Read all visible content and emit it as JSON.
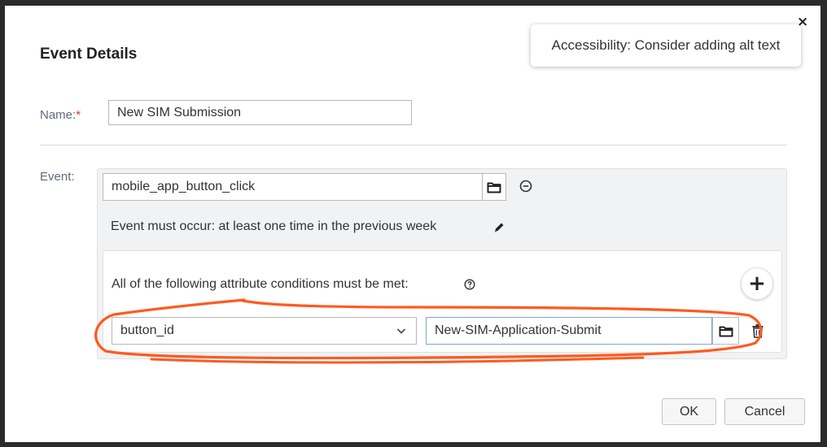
{
  "dialog": {
    "title": "Event Details",
    "close_label": "×"
  },
  "tooltip": {
    "text": "Accessibility: Consider adding alt text"
  },
  "name_field": {
    "label": "Name:",
    "required_marker": "*",
    "value": "New SIM Submission"
  },
  "event": {
    "label": "Event:",
    "value": "mobile_app_button_click",
    "occurrence_text": "Event must occur: at least one time in the previous week",
    "conditions": {
      "heading": "All of the following attribute conditions must be met:",
      "add_label": "+",
      "rows": [
        {
          "attribute": "button_id",
          "value": "New-SIM-Application-Submit"
        }
      ]
    }
  },
  "footer": {
    "ok_label": "OK",
    "cancel_label": "Cancel"
  },
  "colors": {
    "annotation": "#ff5a1f",
    "label": "#5f6b7d",
    "required": "#dd3333"
  }
}
